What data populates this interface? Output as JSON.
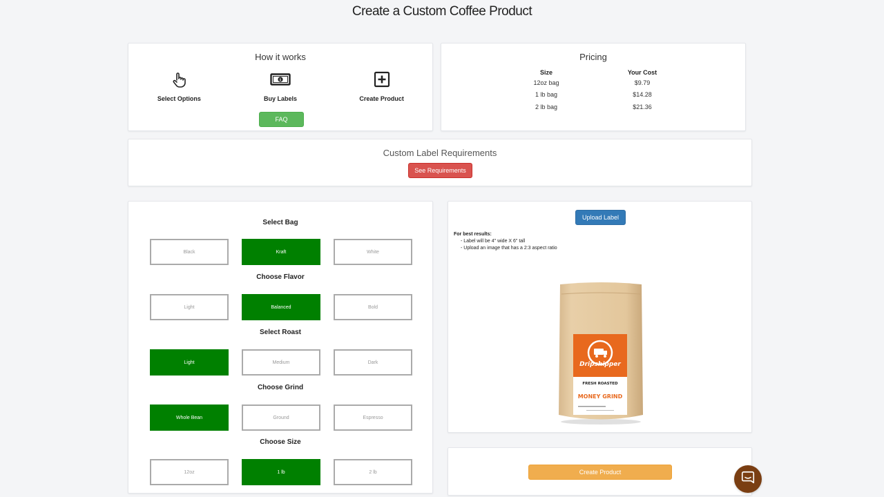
{
  "page": {
    "title": "Create a Custom Coffee Product"
  },
  "how_it_works": {
    "title": "How it works",
    "steps": [
      {
        "label": "Select Options",
        "icon": "pointer-hand-icon"
      },
      {
        "label": "Buy Labels",
        "icon": "money-bill-icon"
      },
      {
        "label": "Create Product",
        "icon": "plus-square-icon"
      }
    ],
    "faq_label": "FAQ"
  },
  "pricing": {
    "title": "Pricing",
    "headers": {
      "size": "Size",
      "cost": "Your Cost"
    },
    "rows": [
      {
        "size": "12oz bag",
        "cost": "$9.79"
      },
      {
        "size": "1 lb bag",
        "cost": "$14.28"
      },
      {
        "size": "2 lb bag",
        "cost": "$21.36"
      }
    ]
  },
  "requirements": {
    "title": "Custom Label Requirements",
    "button_label": "See Requirements"
  },
  "options": {
    "groups": [
      {
        "title": "Select Bag",
        "choices": [
          "Black",
          "Kraft",
          "White"
        ],
        "selected": "Kraft"
      },
      {
        "title": "Choose Flavor",
        "choices": [
          "Light",
          "Balanced",
          "Bold"
        ],
        "selected": "Balanced"
      },
      {
        "title": "Select Roast",
        "choices": [
          "Light",
          "Medium",
          "Dark"
        ],
        "selected": "Light"
      },
      {
        "title": "Choose Grind",
        "choices": [
          "Whole Bean",
          "Ground",
          "Espresso"
        ],
        "selected": "Whole Bean"
      },
      {
        "title": "Choose Size",
        "choices": [
          "12oz",
          "1 lb",
          "2 lb"
        ],
        "selected": "1 lb"
      }
    ]
  },
  "preview": {
    "upload_label": "Upload Label",
    "tips_title": "For best results:",
    "tips": [
      "- Label will be 4\" wide X 6\" tall",
      "- Upload an image that has a 2:3 aspect ratio"
    ],
    "bag_label": {
      "brand": "Dripshipper",
      "line1": "FRESH ROASTED",
      "line2": "MONEY GRIND"
    }
  },
  "create": {
    "button_label": "Create Product"
  },
  "colors": {
    "selected": "#008000",
    "faq": "#5cb85c",
    "requirements": "#d9534f",
    "upload": "#337ab7",
    "create": "#f0ad4e",
    "label_orange": "#e8691e",
    "chat": "#7a3e12"
  },
  "chat": {
    "icon": "chat-bubble-icon"
  }
}
